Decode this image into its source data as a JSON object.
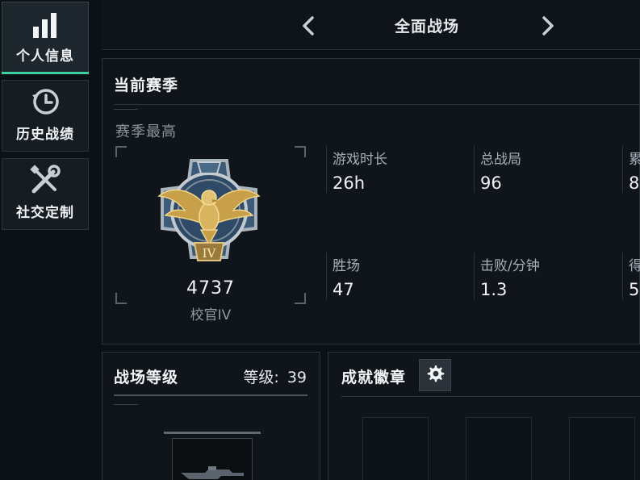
{
  "sidebar": {
    "items": [
      {
        "label": "个人信息",
        "icon": "bar-chart-icon",
        "active": true
      },
      {
        "label": "历史战绩",
        "icon": "history-clock-icon",
        "active": false
      },
      {
        "label": "社交定制",
        "icon": "wrench-screwdriver-icon",
        "active": false
      }
    ]
  },
  "header": {
    "mode_title": "全面战场",
    "prev_icon": "chevron-left-icon",
    "next_icon": "chevron-right-icon"
  },
  "season": {
    "title": "当前赛季",
    "best_label": "赛季最高",
    "rank_score": "4737",
    "rank_name": "校官IV",
    "rank_emblem_numeral": "IV",
    "stats": [
      {
        "label": "游戏时长",
        "value": "26h"
      },
      {
        "label": "总战局",
        "value": "96"
      },
      {
        "label": "累",
        "value": "8"
      },
      {
        "label": "胜场",
        "value": "47"
      },
      {
        "label": "击败/分钟",
        "value": "1.3"
      },
      {
        "label": "得",
        "value": "5"
      }
    ]
  },
  "battlefield_level": {
    "title": "战场等级",
    "level_label": "等级:",
    "level_value": "39"
  },
  "achievements": {
    "title": "成就徽章",
    "settings_icon": "gear-icon"
  },
  "colors": {
    "accent": "#3fd2a1",
    "background": "#0c1116",
    "panel": "#0f151a",
    "border": "#2b333b"
  }
}
